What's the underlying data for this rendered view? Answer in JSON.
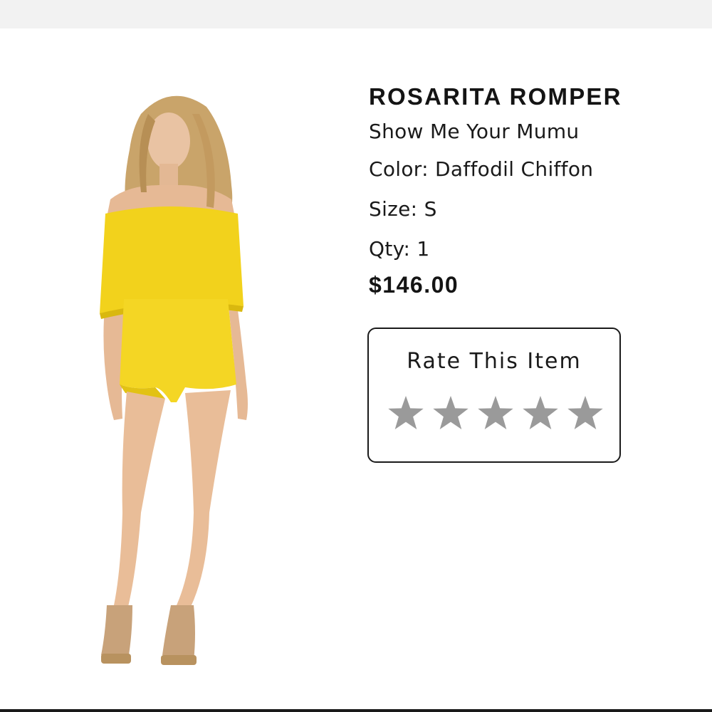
{
  "product": {
    "name": "ROSARITA ROMPER",
    "brand": "Show Me Your Mumu",
    "color": "Color: Daffodil Chiffon",
    "size": "Size: S",
    "quantity": "Qty: 1",
    "price": "$146.00",
    "garment_color": "#f2d21c"
  },
  "rating": {
    "label": "Rate This Item",
    "max_stars": 5,
    "current": 0,
    "star_color": "#9a9a9a"
  }
}
